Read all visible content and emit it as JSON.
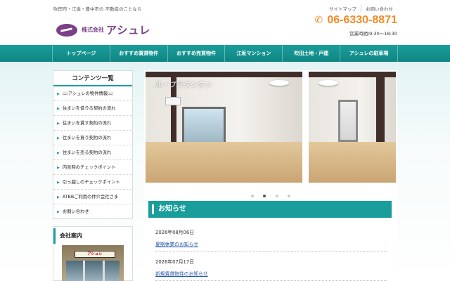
{
  "header": {
    "tagline": "吹田市・江坂・豊中市の 不動産のことなら",
    "logo_company_prefix": "株式会社",
    "logo_company_name": "アシュレ",
    "top_links": [
      "サイトマップ",
      "お問い合わせ"
    ],
    "phone_icon": "phone-icon",
    "phone": "06-6330-8871",
    "hours": "営業時間/9:30〜18:30",
    "accent_color": "#f08a24",
    "brand_color": "#7a3f86"
  },
  "nav": {
    "color": "#1a9e9b",
    "items": [
      "トップページ",
      "おすすめ賃貸物件",
      "おすすめ売買物件",
      "江坂マンション",
      "吹田土地・戸建",
      "アシュレの駐車場"
    ]
  },
  "sidebar": {
    "title": "コンテンツ一覧",
    "items": [
      "📖アシュレの物件情報📖",
      "住まいを借りる契約の流れ",
      "住まいを貸す契約の流れ",
      "住まいを買う契約の流れ",
      "住まいを売る契約の流れ",
      "内見時のチェックポイント",
      "引っ越しのチェックポイント",
      "ATBBご利用の仲介会社さま",
      "お問い合わせ"
    ]
  },
  "company": {
    "title": "会社案内",
    "sign_text": "アシュレ"
  },
  "slider": {
    "caption": "ル・プラタンタン",
    "dots_total": 4,
    "active_dot": 1
  },
  "news": {
    "title": "お知らせ",
    "items": [
      {
        "date": "2026年08月06日",
        "text": "夏期休業のお知らせ"
      },
      {
        "date": "2026年07月17日",
        "text": "新規賃貸物件のお知らせ"
      }
    ]
  }
}
